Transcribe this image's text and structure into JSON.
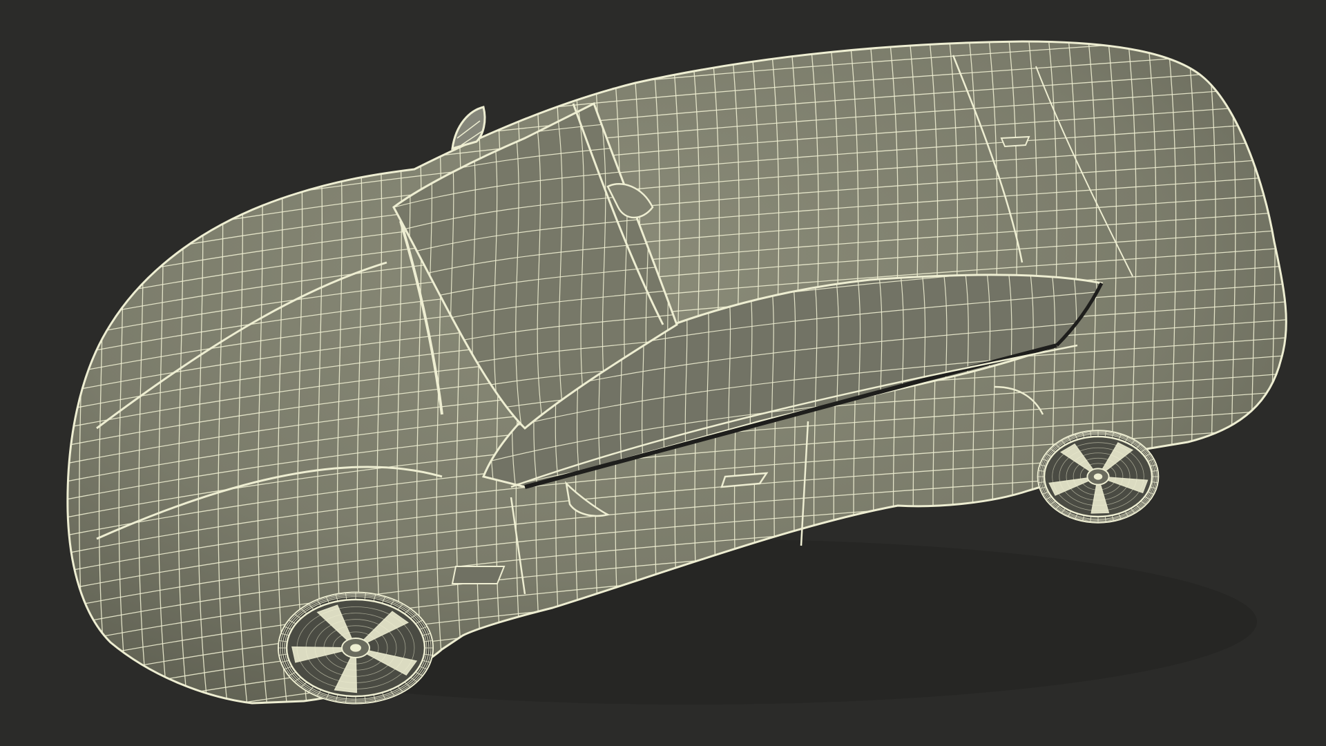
{
  "scene": {
    "subject": "car-wireframe",
    "background_color": "#2b2b29",
    "body_fill_color": "#7c7d6c",
    "body_fill_light": "#888976",
    "body_fill_shadow": "#5d5e51",
    "wire_color": "#eeeed2",
    "window_color": "#6e6f61",
    "tire_color": "#3a3b35",
    "rim_color": "#e8e8cc"
  }
}
